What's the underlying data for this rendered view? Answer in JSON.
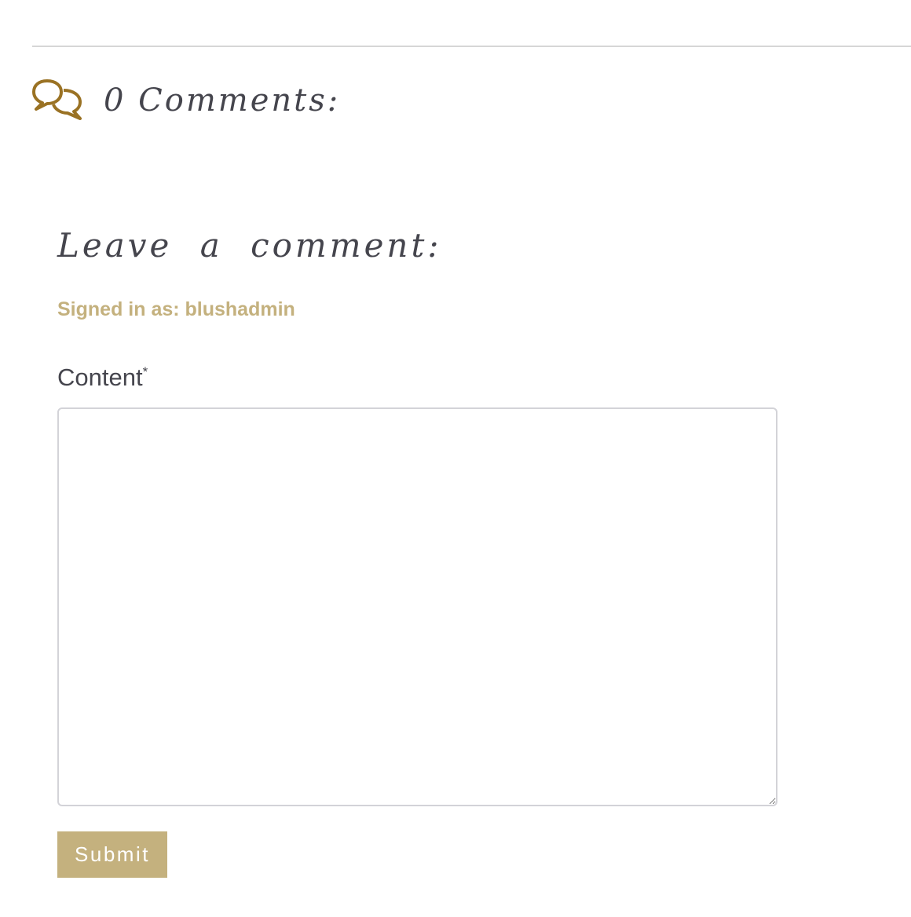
{
  "comments": {
    "icon": "speech-bubbles-icon",
    "count_label": "0 Comments:"
  },
  "form": {
    "title": "Leave a comment:",
    "signed_in_text": "Signed in as: blushadmin",
    "content_label": "Content",
    "required_marker": "*",
    "content_value": "",
    "submit_label": "Submit"
  },
  "colors": {
    "accent": "#c4b17e",
    "icon": "#9a7224",
    "text": "#45454d",
    "divider": "#d6d6d6",
    "input_border": "#d3d3d8"
  }
}
